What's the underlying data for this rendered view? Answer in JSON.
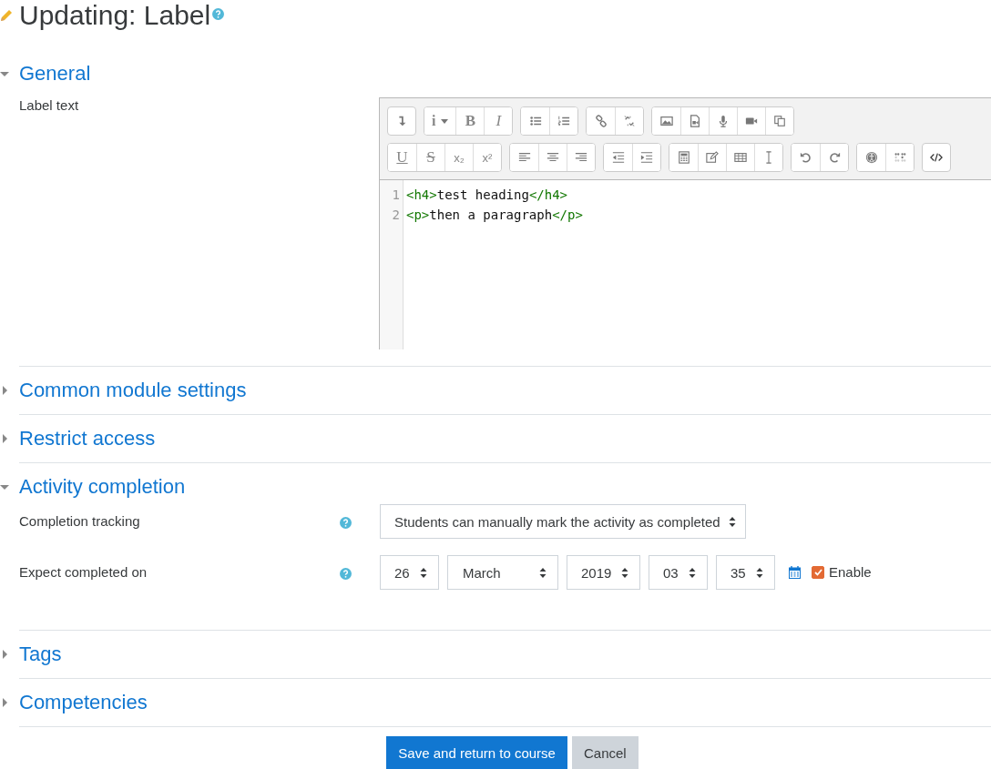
{
  "page_title": "Updating: Label",
  "sections": [
    {
      "title": "General",
      "expanded": true,
      "fields": [
        {
          "kind": "editor",
          "label": "Label text",
          "toolbar": [
            [
              [
                {
                  "kind": "collapse"
                }
              ],
              [
                {
                  "kind": "info",
                  "text": "i"
                },
                {
                  "kind": "bold",
                  "text": "B"
                },
                {
                  "kind": "italic",
                  "text": "I"
                }
              ],
              [
                {
                  "kind": "bullets"
                },
                {
                  "kind": "numbers"
                }
              ],
              [
                {
                  "kind": "link"
                },
                {
                  "kind": "unlink"
                }
              ],
              [
                {
                  "kind": "image"
                },
                {
                  "kind": "media"
                },
                {
                  "kind": "microphone"
                },
                {
                  "kind": "video"
                },
                {
                  "kind": "copy"
                }
              ]
            ],
            [
              [
                {
                  "kind": "underline",
                  "text": "U"
                },
                {
                  "kind": "strike",
                  "text": "S"
                },
                {
                  "kind": "subscript",
                  "text": "x₂"
                },
                {
                  "kind": "superscript",
                  "text": "x²"
                }
              ],
              [
                {
                  "kind": "align-left"
                },
                {
                  "kind": "align-center"
                },
                {
                  "kind": "align-right"
                }
              ],
              [
                {
                  "kind": "outdent"
                },
                {
                  "kind": "indent"
                }
              ],
              [
                {
                  "kind": "calculator"
                },
                {
                  "kind": "pencil"
                },
                {
                  "kind": "table"
                },
                {
                  "kind": "cursor"
                }
              ],
              [
                {
                  "kind": "undo"
                },
                {
                  "kind": "redo"
                }
              ],
              [
                {
                  "kind": "accessibility"
                },
                {
                  "kind": "dots"
                }
              ],
              [
                {
                  "kind": "code"
                }
              ]
            ]
          ],
          "lines": [
            {
              "number": "1",
              "tokens": [
                {
                  "kind": "tag",
                  "text": "<h4>"
                },
                {
                  "kind": "text",
                  "text": "test heading"
                },
                {
                  "kind": "tag",
                  "text": "</h4>"
                }
              ]
            },
            {
              "number": "2",
              "tokens": [
                {
                  "kind": "tag",
                  "text": "<p>"
                },
                {
                  "kind": "text",
                  "text": "then a paragraph"
                },
                {
                  "kind": "tag",
                  "text": "</p>"
                }
              ]
            }
          ]
        }
      ]
    },
    {
      "title": "Common module settings",
      "expanded": false
    },
    {
      "title": "Restrict access",
      "expanded": false
    },
    {
      "title": "Activity completion",
      "expanded": true,
      "fields": [
        {
          "kind": "select",
          "label": "Completion tracking",
          "value": "Students can manually mark the activity as completed"
        },
        {
          "kind": "date",
          "label": "Expect completed on",
          "parts": [
            "26",
            "March",
            "2019",
            "03",
            "35"
          ],
          "enable": {
            "label": "Enable",
            "checked": true
          }
        }
      ]
    },
    {
      "title": "Tags",
      "expanded": false
    },
    {
      "title": "Competencies",
      "expanded": false
    }
  ],
  "buttons": [
    {
      "label": "Save and return to course",
      "kind": "primary"
    },
    {
      "label": "Cancel",
      "kind": "secondary"
    }
  ]
}
